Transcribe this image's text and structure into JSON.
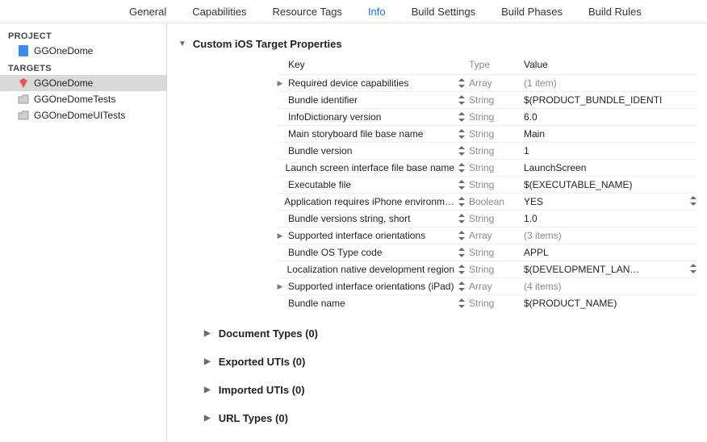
{
  "tabs": {
    "general": "General",
    "capabilities": "Capabilities",
    "resource_tags": "Resource Tags",
    "info": "Info",
    "build_settings": "Build Settings",
    "build_phases": "Build Phases",
    "build_rules": "Build Rules"
  },
  "sidebar": {
    "project_label": "PROJECT",
    "project_item": "GGOneDome",
    "targets_label": "TARGETS",
    "targets": [
      {
        "name": "GGOneDome",
        "icon": "app-red",
        "selected": true
      },
      {
        "name": "GGOneDomeTests",
        "icon": "folder",
        "selected": false
      },
      {
        "name": "GGOneDomeUITests",
        "icon": "folder",
        "selected": false
      }
    ]
  },
  "sections": {
    "custom_props": "Custom iOS Target Properties",
    "document_types": "Document Types (0)",
    "exported_utis": "Exported UTIs (0)",
    "imported_utis": "Imported UTIs (0)",
    "url_types": "URL Types (0)"
  },
  "headers": {
    "key": "Key",
    "type": "Type",
    "value": "Value"
  },
  "rows": [
    {
      "key": "Required device capabilities",
      "type": "Array",
      "value": "(1 item)",
      "expandable": true,
      "muted": true
    },
    {
      "key": "Bundle identifier",
      "type": "String",
      "value": "$(PRODUCT_BUNDLE_IDENTI",
      "expandable": false
    },
    {
      "key": "InfoDictionary version",
      "type": "String",
      "value": "6.0",
      "expandable": false
    },
    {
      "key": "Main storyboard file base name",
      "type": "String",
      "value": "Main",
      "expandable": false
    },
    {
      "key": "Bundle version",
      "type": "String",
      "value": "1",
      "expandable": false
    },
    {
      "key": "Launch screen interface file base name",
      "type": "String",
      "value": "LaunchScreen",
      "expandable": false
    },
    {
      "key": "Executable file",
      "type": "String",
      "value": "$(EXECUTABLE_NAME)",
      "expandable": false
    },
    {
      "key": "Application requires iPhone environm…",
      "type": "Boolean",
      "value": "YES",
      "expandable": false,
      "value_stepper": true
    },
    {
      "key": "Bundle versions string, short",
      "type": "String",
      "value": "1.0",
      "expandable": false
    },
    {
      "key": "Supported interface orientations",
      "type": "Array",
      "value": "(3 items)",
      "expandable": true,
      "muted": true
    },
    {
      "key": "Bundle OS Type code",
      "type": "String",
      "value": "APPL",
      "expandable": false
    },
    {
      "key": "Localization native development region",
      "type": "String",
      "value": "$(DEVELOPMENT_LAN…",
      "expandable": false,
      "value_stepper": true
    },
    {
      "key": "Supported interface orientations (iPad)",
      "type": "Array",
      "value": "(4 items)",
      "expandable": true,
      "muted": true
    },
    {
      "key": "Bundle name",
      "type": "String",
      "value": "$(PRODUCT_NAME)",
      "expandable": false
    }
  ]
}
